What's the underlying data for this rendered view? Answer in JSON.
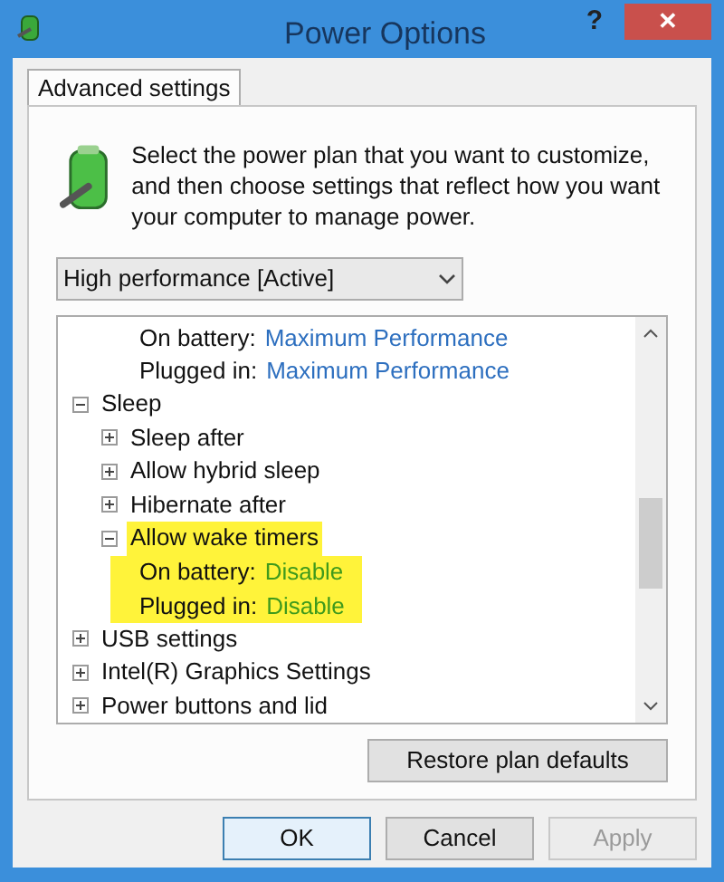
{
  "window": {
    "title": "Power Options",
    "help": "?",
    "close": "✕"
  },
  "tabs": [
    {
      "label": "Advanced settings",
      "selected": true
    }
  ],
  "intro": "Select the power plan that you want to customize, and then choose settings that reflect how you want your computer to manage power.",
  "plan_select": {
    "value": "High performance [Active]"
  },
  "tree": [
    {
      "kind": "continuation",
      "children": [
        {
          "kind": "continuation",
          "children": [
            {
              "kind": "value",
              "label": "On battery:",
              "value": "Maximum Performance",
              "highlighted": false
            },
            {
              "kind": "value",
              "label": "Plugged in:",
              "value": "Maximum Performance",
              "highlighted": false
            }
          ]
        }
      ]
    },
    {
      "kind": "group",
      "label": "Sleep",
      "expanded": true,
      "highlighted": false,
      "children": [
        {
          "kind": "group",
          "label": "Sleep after",
          "expanded": false,
          "highlighted": false
        },
        {
          "kind": "group",
          "label": "Allow hybrid sleep",
          "expanded": false,
          "highlighted": false
        },
        {
          "kind": "group",
          "label": "Hibernate after",
          "expanded": false,
          "highlighted": false
        },
        {
          "kind": "group",
          "label": "Allow wake timers",
          "expanded": true,
          "highlighted": true,
          "children": [
            {
              "kind": "value",
              "label": "On battery:",
              "value": "Disable",
              "highlighted": true
            },
            {
              "kind": "value",
              "label": "Plugged in:",
              "value": "Disable",
              "highlighted": true
            }
          ]
        }
      ]
    },
    {
      "kind": "group",
      "label": "USB settings",
      "expanded": false,
      "highlighted": false
    },
    {
      "kind": "group",
      "label": "Intel(R) Graphics Settings",
      "expanded": false,
      "highlighted": false
    },
    {
      "kind": "group",
      "label": "Power buttons and lid",
      "expanded": false,
      "highlighted": false
    }
  ],
  "restore_button": "Restore plan defaults",
  "buttons": [
    {
      "label": "OK",
      "default": true,
      "disabled": false
    },
    {
      "label": "Cancel",
      "default": false,
      "disabled": false
    },
    {
      "label": "Apply",
      "default": false,
      "disabled": true
    }
  ]
}
